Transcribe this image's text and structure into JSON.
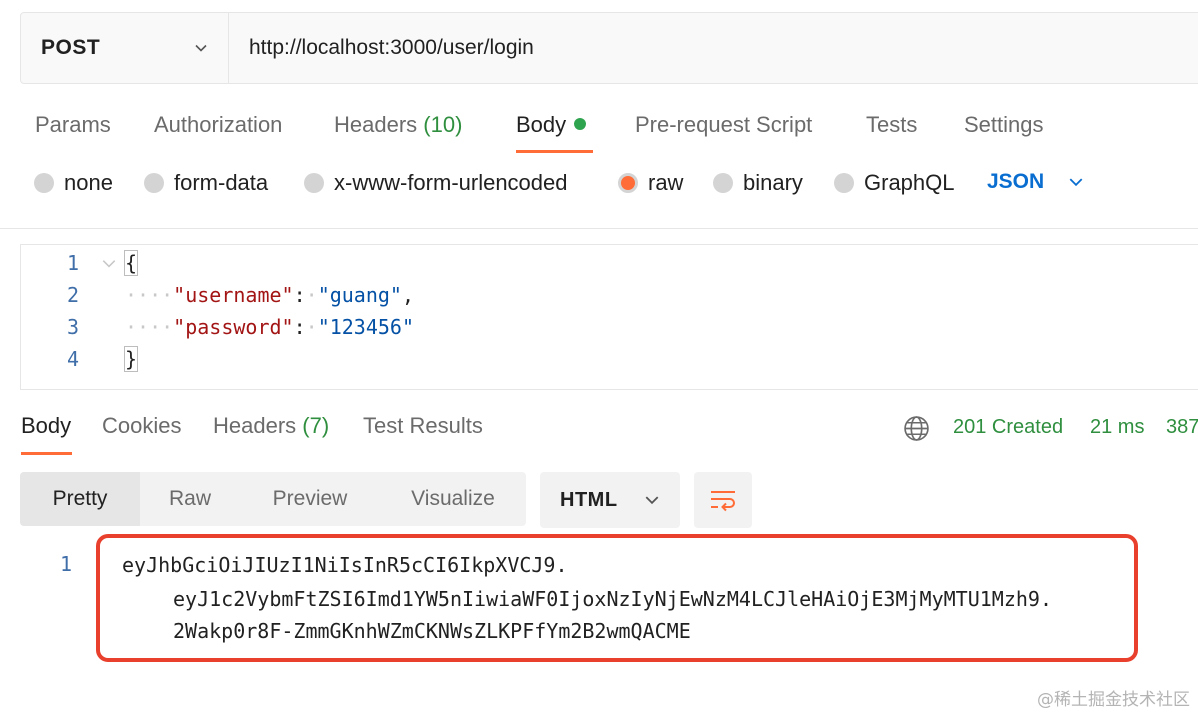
{
  "request": {
    "method": "POST",
    "url": "http://localhost:3000/user/login"
  },
  "request_tabs": [
    {
      "label": "Params"
    },
    {
      "label": "Authorization"
    },
    {
      "label": "Headers",
      "count": "(10)"
    },
    {
      "label": "Body",
      "active": true
    },
    {
      "label": "Pre-request Script"
    },
    {
      "label": "Tests"
    },
    {
      "label": "Settings"
    }
  ],
  "body_types": [
    "none",
    "form-data",
    "x-www-form-urlencoded",
    "raw",
    "binary",
    "GraphQL"
  ],
  "body_type_selected": "raw",
  "body_format": "JSON",
  "editor": {
    "line_numbers": [
      "1",
      "2",
      "3",
      "4"
    ],
    "open_brace": "{",
    "close_brace": "}",
    "fields": [
      {
        "key": "\"username\"",
        "value": "\"guang\"",
        "trailing": ","
      },
      {
        "key": "\"password\"",
        "value": "\"123456\"",
        "trailing": ""
      }
    ]
  },
  "response_tabs": [
    {
      "label": "Body",
      "active": true
    },
    {
      "label": "Cookies"
    },
    {
      "label": "Headers",
      "count": "(7)"
    },
    {
      "label": "Test Results"
    }
  ],
  "response_status": {
    "status": "201 Created",
    "time": "21 ms",
    "size": "387"
  },
  "view_modes": [
    "Pretty",
    "Raw",
    "Preview",
    "Visualize"
  ],
  "view_mode_selected": "Pretty",
  "response_format": "HTML",
  "response_body": {
    "line_number": "1",
    "lines": [
      "eyJhbGciOiJIUzI1NiIsInR5cCI6IkpXVCJ9.",
      "eyJ1c2VybmFtZSI6Imd1YW5nIiwiaWF0IjoxNzIyNjEwNzM4LCJleHAiOjE3MjMyMTU1Mzh9.",
      "2Wakp0r8F-ZmmGKnhWZmCKNWsZLKPFfYm2B2wmQACME"
    ]
  },
  "watermark": "@稀土掘金技术社区",
  "colors": {
    "accent": "#ff6c37",
    "success": "#2f8f3f",
    "link_blue": "#0a6ed1",
    "highlight_border": "#e8402d"
  }
}
